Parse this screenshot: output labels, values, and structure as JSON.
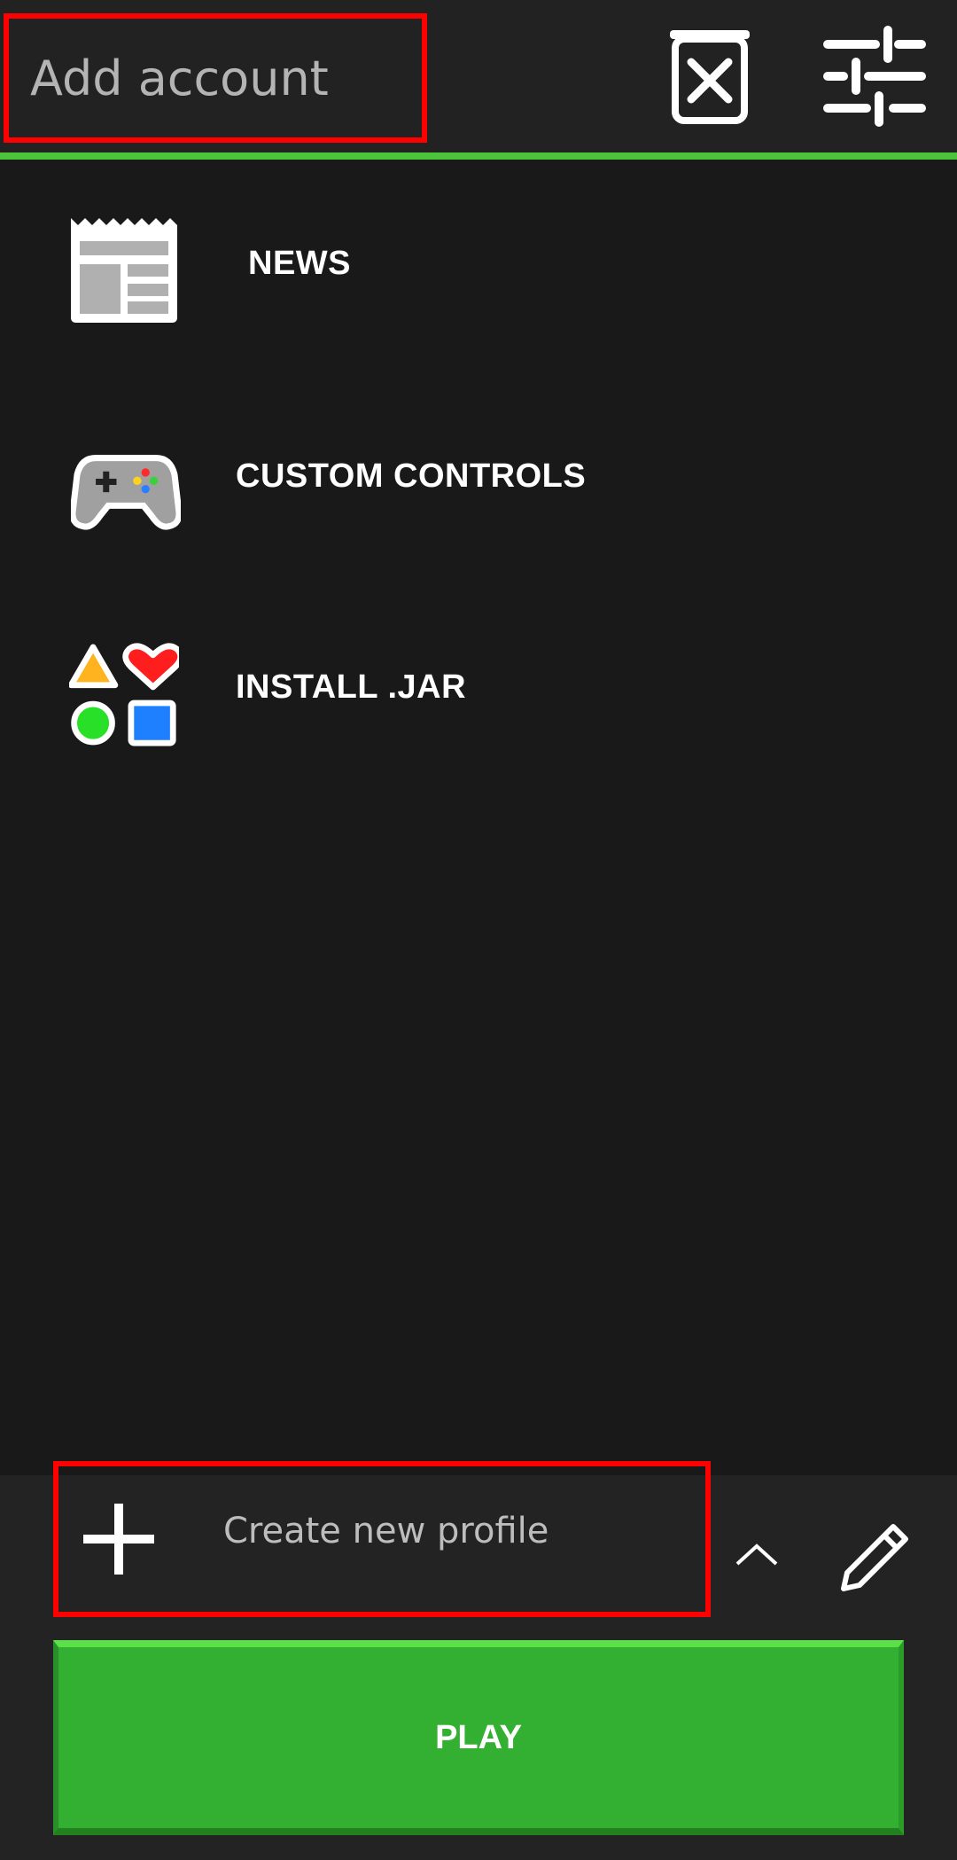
{
  "header": {
    "account_selector_label": "Add account",
    "delete_icon": "delete-clipboard-icon",
    "settings_icon": "sliders-icon"
  },
  "menu": {
    "items": [
      {
        "label": "NEWS",
        "icon": "newspaper-icon"
      },
      {
        "label": "CUSTOM CONTROLS",
        "icon": "gamepad-icon"
      },
      {
        "label": "INSTALL .JAR",
        "icon": "shapes-icon"
      }
    ]
  },
  "profile": {
    "label": "Create new profile",
    "icon": "plus-icon"
  },
  "actions": {
    "expand_icon": "chevron-up-icon",
    "edit_icon": "pencil-icon",
    "play_label": "PLAY"
  },
  "colors": {
    "accent_green": "#4cc43a",
    "play_green": "#33b032",
    "highlight_red": "#ff0000",
    "background": "#191919",
    "panel": "#232323"
  }
}
